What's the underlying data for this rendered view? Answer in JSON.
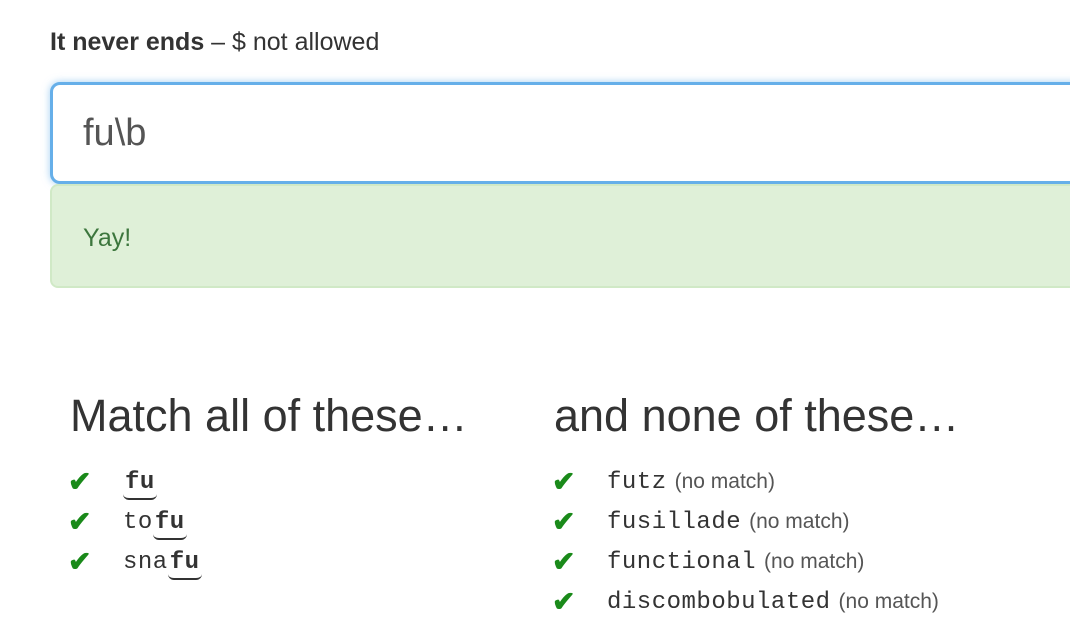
{
  "header": {
    "title_bold": "It never ends",
    "title_rest": " – $ not allowed"
  },
  "input": {
    "value": "fu\\b"
  },
  "alert": {
    "text": "Yay!"
  },
  "match_column": {
    "heading": "Match all of these…",
    "items": [
      {
        "pre": "",
        "hl": "fu",
        "post": ""
      },
      {
        "pre": "to",
        "hl": "fu",
        "post": ""
      },
      {
        "pre": "sna",
        "hl": "fu",
        "post": ""
      }
    ]
  },
  "nomatch_column": {
    "heading": "and none of these…",
    "items": [
      {
        "word": "futz",
        "note": "(no match)"
      },
      {
        "word": "fusillade",
        "note": "(no match)"
      },
      {
        "word": "functional",
        "note": "(no match)"
      },
      {
        "word": "discombobulated",
        "note": "(no match)"
      }
    ]
  },
  "check_icon": "✔",
  "colors": {
    "check": "#1a8a1a",
    "alert_bg": "#dff0d8",
    "alert_text": "#3c763d",
    "input_border": "#66afe9"
  }
}
